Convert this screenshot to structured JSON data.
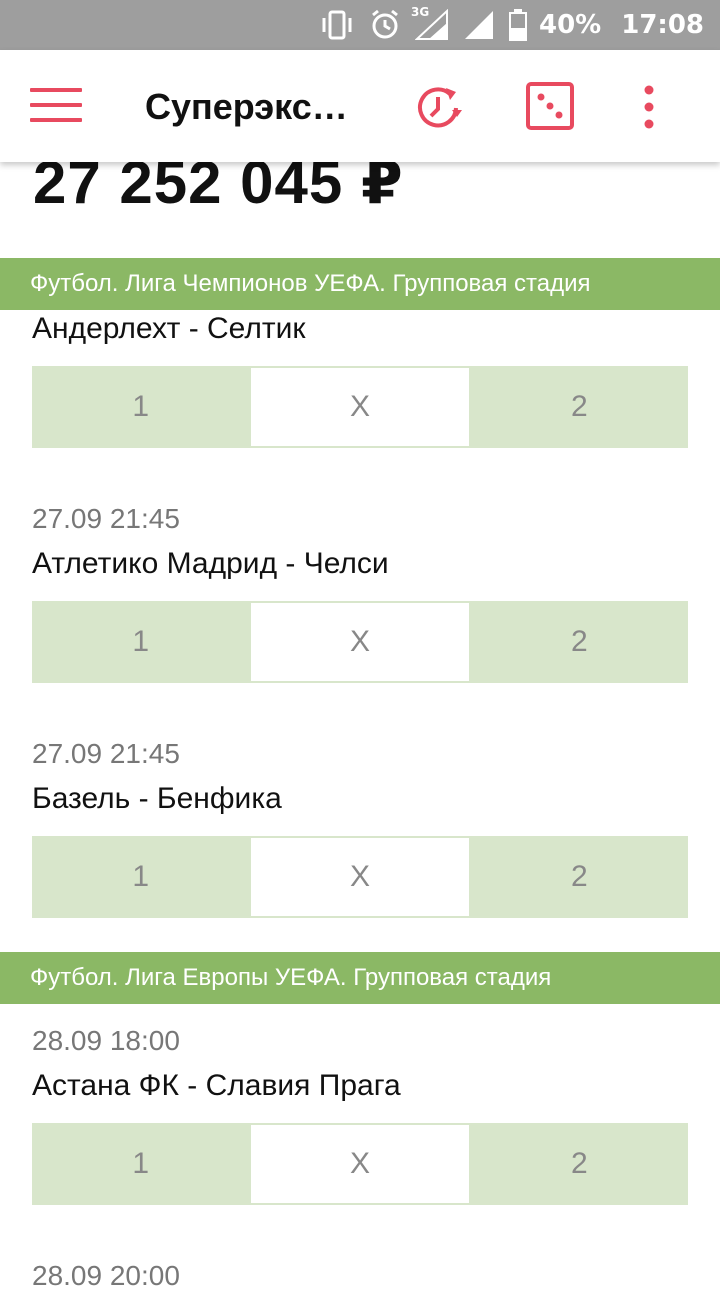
{
  "status_bar": {
    "network": "3G",
    "battery": "40%",
    "time": "17:08"
  },
  "app_bar": {
    "title": "Суперэкс…",
    "icons": [
      "menu-icon",
      "history-clock-icon",
      "dice-icon",
      "more-vert-icon"
    ]
  },
  "jackpot": {
    "amount": "27 252 045 ₽"
  },
  "leagues": [
    {
      "name": "Футбол. Лига Чемпионов УЕФА. Групповая стадия",
      "matches": [
        {
          "date": "",
          "teams": "Андерлехт - Селтик",
          "outcomes": [
            "1",
            "X",
            "2"
          ]
        },
        {
          "date": "27.09 21:45",
          "teams": "Атлетико Мадрид - Челси",
          "outcomes": [
            "1",
            "X",
            "2"
          ]
        },
        {
          "date": "27.09 21:45",
          "teams": "Базель - Бенфика",
          "outcomes": [
            "1",
            "X",
            "2"
          ]
        }
      ]
    },
    {
      "name": "Футбол. Лига Европы УЕФА. Групповая стадия",
      "matches": [
        {
          "date": "28.09 18:00",
          "teams": "Астана ФК - Славия Прага",
          "outcomes": [
            "1",
            "X",
            "2"
          ]
        },
        {
          "date": "28.09 20:00",
          "teams": "",
          "outcomes": []
        }
      ]
    }
  ],
  "colors": {
    "accent": "#e84a5f",
    "league_bar": "#8bb865",
    "odds_cell": "#d8e6cb",
    "status_bar": "#9e9e9e"
  }
}
